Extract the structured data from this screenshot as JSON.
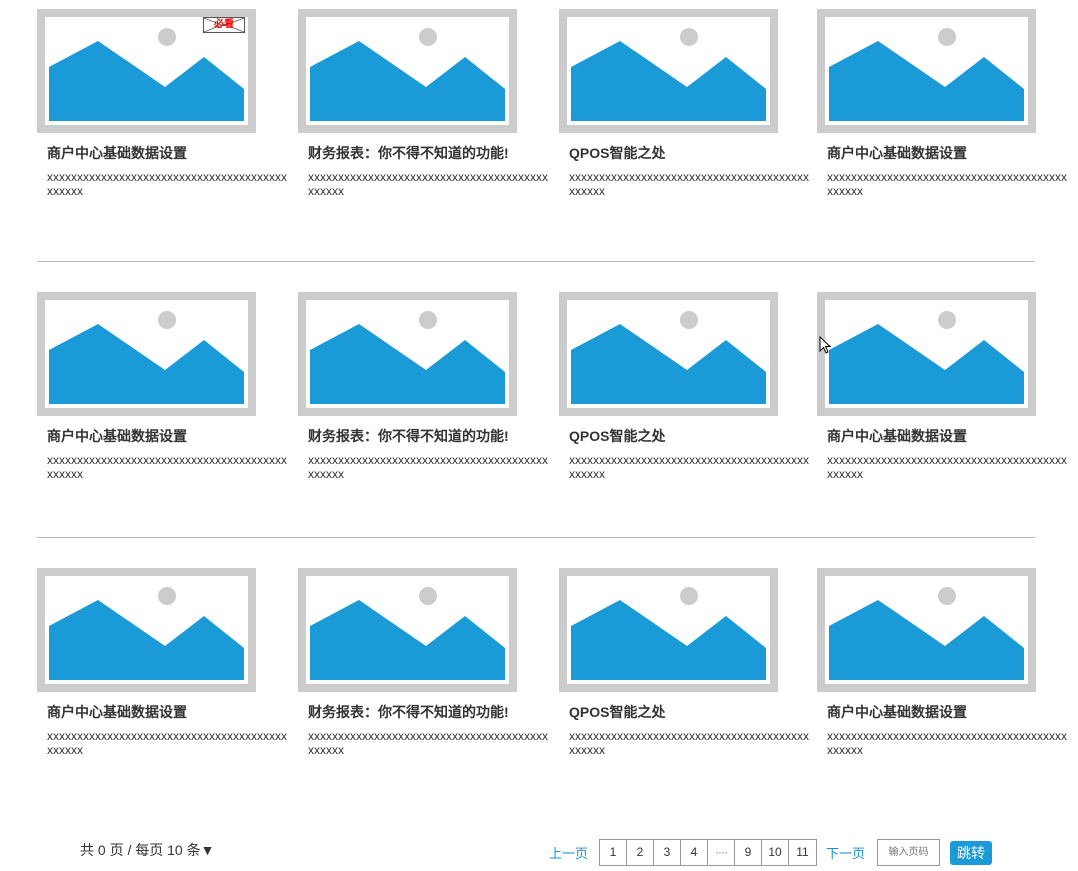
{
  "cards": [
    {
      "title": "商户中心基础数据设置",
      "desc": "xxxxxxxxxxxxxxxxxxxxxxxxxxxxxxxxxxxxxxxxxxxxxx",
      "badge": "必看"
    },
    {
      "title": "财务报表：你不得不知道的功能!",
      "desc": "xxxxxxxxxxxxxxxxxxxxxxxxxxxxxxxxxxxxxxxxxxxxxx"
    },
    {
      "title": "QPOS智能之处",
      "desc": "xxxxxxxxxxxxxxxxxxxxxxxxxxxxxxxxxxxxxxxxxxxxxx"
    },
    {
      "title": "商户中心基础数据设置",
      "desc": "xxxxxxxxxxxxxxxxxxxxxxxxxxxxxxxxxxxxxxxxxxxxxx"
    },
    {
      "title": "商户中心基础数据设置",
      "desc": "xxxxxxxxxxxxxxxxxxxxxxxxxxxxxxxxxxxxxxxxxxxxxx"
    },
    {
      "title": "财务报表：你不得不知道的功能!",
      "desc": "xxxxxxxxxxxxxxxxxxxxxxxxxxxxxxxxxxxxxxxxxxxxxx"
    },
    {
      "title": "QPOS智能之处",
      "desc": "xxxxxxxxxxxxxxxxxxxxxxxxxxxxxxxxxxxxxxxxxxxxxx"
    },
    {
      "title": "商户中心基础数据设置",
      "desc": "xxxxxxxxxxxxxxxxxxxxxxxxxxxxxxxxxxxxxxxxxxxxxx"
    },
    {
      "title": "商户中心基础数据设置",
      "desc": "xxxxxxxxxxxxxxxxxxxxxxxxxxxxxxxxxxxxxxxxxxxxxx"
    },
    {
      "title": "财务报表：你不得不知道的功能!",
      "desc": "xxxxxxxxxxxxxxxxxxxxxxxxxxxxxxxxxxxxxxxxxxxxxx"
    },
    {
      "title": "QPOS智能之处",
      "desc": "xxxxxxxxxxxxxxxxxxxxxxxxxxxxxxxxxxxxxxxxxxxxxx"
    },
    {
      "title": "商户中心基础数据设置",
      "desc": "xxxxxxxxxxxxxxxxxxxxxxxxxxxxxxxxxxxxxxxxxxxxxx"
    }
  ],
  "image_icon": "image-placeholder-icon",
  "colors": {
    "frame": "#cccccc",
    "mountain": "#1a9ad6",
    "sun": "#cccccc",
    "link": "#1a8fd6",
    "button": "#1a9ad6",
    "divider": "#bbbbbb"
  },
  "pagination": {
    "info": "共 0 页 / 每页 10 条",
    "per_page_arrow": "▼",
    "prev_label": "上一页",
    "next_label": "下一页",
    "pages": [
      "1",
      "2",
      "3",
      "4",
      "····",
      "9",
      "10",
      "11"
    ],
    "goto_placeholder": "输入页码",
    "goto_label": "跳转"
  }
}
